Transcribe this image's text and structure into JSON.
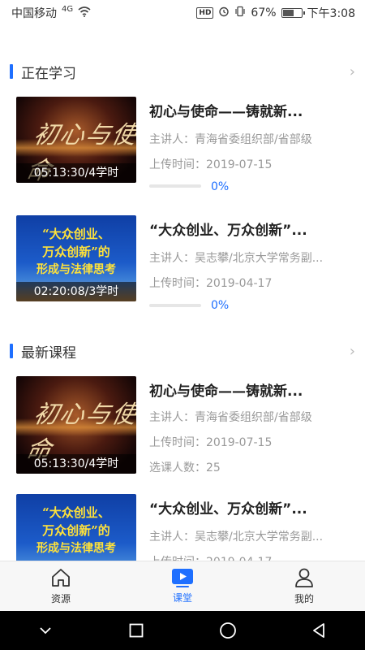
{
  "status_bar": {
    "carrier": "中国移动",
    "network": "4G",
    "hd": "HD",
    "battery_percent": "67%",
    "battery_level": 0.67,
    "time": "下午3:08"
  },
  "sections": [
    {
      "title": "正在学习",
      "courses": [
        {
          "thumb_style": "red",
          "thumb_art": "初心与使命",
          "thumb_caption": "05:13:30/4学时",
          "title": "初心与使命——铸就新...",
          "lecturer": "主讲人：青海省委组织部/省部级",
          "upload": "上传时间：2019-07-15",
          "progress_text": "0%",
          "progress": 0
        },
        {
          "thumb_style": "blue",
          "thumb_lines": [
            "“大众创业、",
            "万众创新”的",
            "形成与法律思考"
          ],
          "thumb_caption": "02:20:08/3学时",
          "title": "“大众创业、万众创新”...",
          "lecturer": "主讲人：吴志攀/北京大学常务副...",
          "upload": "上传时间：2019-04-17",
          "progress_text": "0%",
          "progress": 0
        }
      ]
    },
    {
      "title": "最新课程",
      "courses": [
        {
          "thumb_style": "red",
          "thumb_art": "初心与使命",
          "thumb_caption": "05:13:30/4学时",
          "title": "初心与使命——铸就新...",
          "lecturer": "主讲人：青海省委组织部/省部级",
          "upload": "上传时间：2019-07-15",
          "enroll": "选课人数：25"
        },
        {
          "thumb_style": "blue",
          "thumb_lines": [
            "“大众创业、",
            "万众创新”的",
            "形成与法律思考"
          ],
          "title": "“大众创业、万众创新”...",
          "lecturer": "主讲人：吴志攀/北京大学常务副...",
          "upload": "上传时间：2019-04-17"
        }
      ]
    }
  ],
  "tab_bar": {
    "tabs": [
      {
        "label": "资源",
        "icon": "home-icon",
        "active": false
      },
      {
        "label": "课堂",
        "icon": "play-icon",
        "active": true
      },
      {
        "label": "我的",
        "icon": "user-icon",
        "active": false
      }
    ]
  },
  "nav_bar": {
    "buttons": [
      "collapse-icon",
      "recents-icon",
      "home-circle-icon",
      "back-icon"
    ]
  },
  "colors": {
    "accent": "#1e6fff",
    "muted_text": "#999999"
  }
}
